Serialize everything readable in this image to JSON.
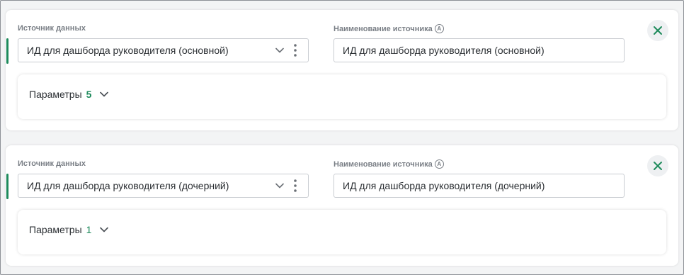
{
  "colors": {
    "accent": "#1d8a5b",
    "close_icon": "#1d8a5b",
    "label": "#7a7f86"
  },
  "icons": {
    "chevron": "chevron-down-icon",
    "menu": "more-vertical-icon",
    "close": "close-icon",
    "auto_name": "auto-circle-a-icon"
  },
  "sources": [
    {
      "source_label": "Источник данных",
      "source_value": "ИД для дашборда руководителя (основной)",
      "name_label": "Наименование источника",
      "auto_badge": "A",
      "name_value": "ИД для дашборда руководителя (основной)",
      "params_label": "Параметры",
      "params_count": "5"
    },
    {
      "source_label": "Источник данных",
      "source_value": "ИД для дашборда руководителя (дочерний)",
      "name_label": "Наименование источника",
      "auto_badge": "A",
      "name_value": "ИД для дашборда руководителя (дочерний)",
      "params_label": "Параметры",
      "params_count": "1"
    }
  ]
}
